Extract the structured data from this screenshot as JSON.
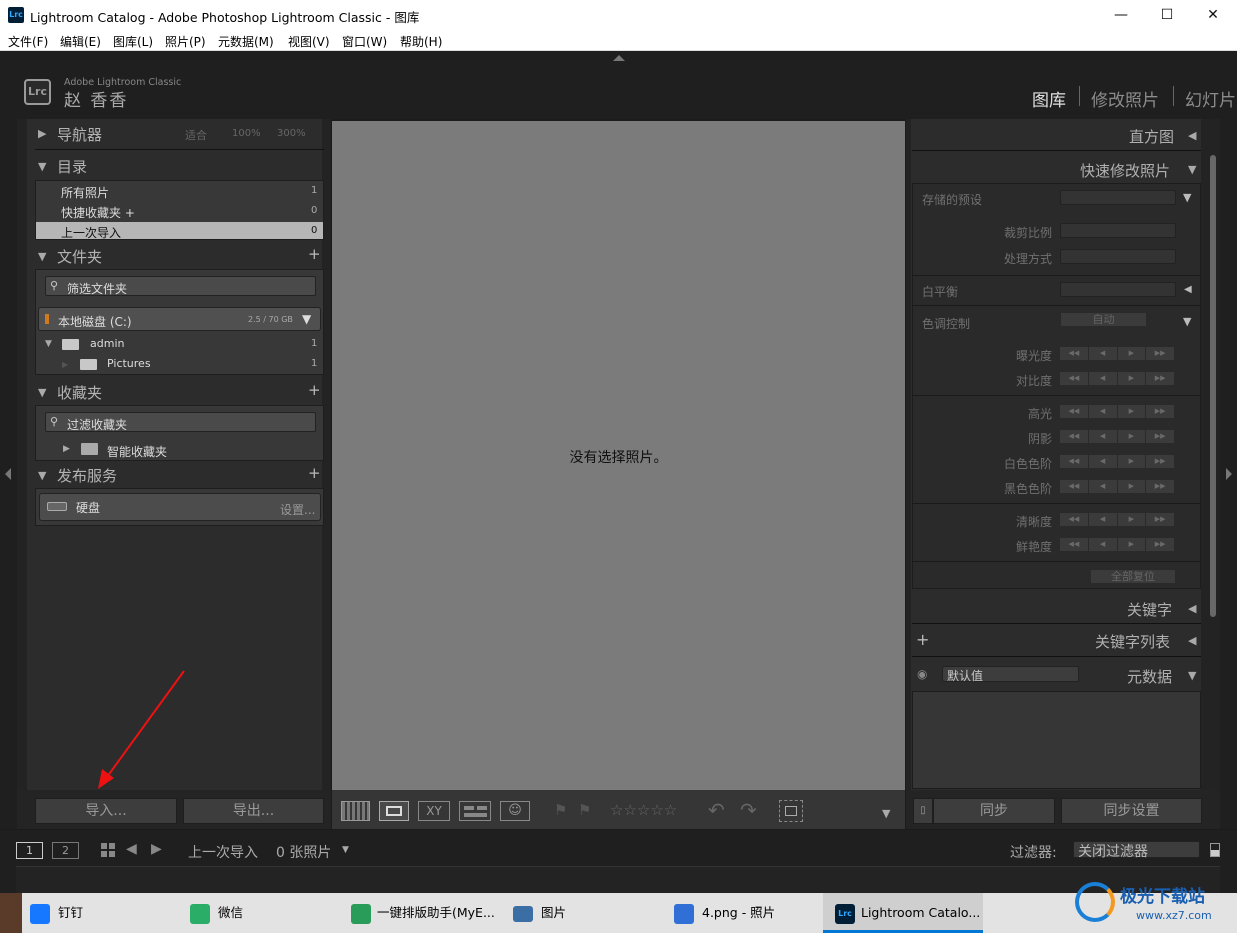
{
  "window": {
    "title": "Lightroom Catalog - Adobe Photoshop Lightroom Classic - 图库",
    "app_icon": "Lrc",
    "minimize": "—",
    "maximize": "☐",
    "close": "✕"
  },
  "menu": [
    "文件(F)",
    "编辑(E)",
    "图库(L)",
    "照片(P)",
    "元数据(M)",
    "视图(V)",
    "窗口(W)",
    "帮助(H)"
  ],
  "identity": {
    "logo": "Lrc",
    "brand": "Adobe Lightroom Classic",
    "name": "赵 香香"
  },
  "modules": [
    "图库",
    "修改照片",
    "幻灯片"
  ],
  "left": {
    "navigator": {
      "title": "导航器",
      "zoom": [
        "适合",
        "100%",
        "300%"
      ]
    },
    "catalog": {
      "title": "目录",
      "items": [
        {
          "label": "所有照片",
          "count": "1"
        },
        {
          "label": "快捷收藏夹 +",
          "count": "0"
        },
        {
          "label": "上一次导入",
          "count": "0"
        }
      ]
    },
    "folders": {
      "title": "文件夹",
      "filter_placeholder": "筛选文件夹",
      "volume": "本地磁盘 (C:)",
      "volume_size": "2.5 / 70 GB",
      "tree": [
        {
          "label": "admin",
          "count": "1"
        },
        {
          "label": "Pictures",
          "count": "1"
        }
      ]
    },
    "collections": {
      "title": "收藏夹",
      "filter_placeholder": "过滤收藏夹",
      "smart": "智能收藏夹"
    },
    "publish": {
      "title": "发布服务",
      "service": "硬盘",
      "setup": "设置..."
    },
    "import_button": "导入...",
    "export_button": "导出..."
  },
  "center": {
    "empty_message": "没有选择照片。"
  },
  "right": {
    "histogram": "直方图",
    "quick_develop": {
      "title": "快速修改照片",
      "saved_preset": "存储的预设",
      "crop_ratio": "裁剪比例",
      "treatment": "处理方式",
      "white_balance": "白平衡",
      "tone_control": "色调控制",
      "auto": "自动",
      "group1": [
        "曝光度",
        "对比度"
      ],
      "group2": [
        "高光",
        "阴影",
        "白色色阶",
        "黑色色阶"
      ],
      "group3": [
        "清晰度",
        "鲜艳度"
      ],
      "reset_all": "全部复位"
    },
    "keywords": "关键字",
    "keyword_list": "关键字列表",
    "metadata": "元数据",
    "metadata_preset": "默认值",
    "sync_button": "同步",
    "sync_settings_button": "同步设置"
  },
  "filmstrip": {
    "view1": "1",
    "view2": "2",
    "source": "上一次导入",
    "count": "0 张照片",
    "filter_label": "过滤器:",
    "filter_value": "关闭过滤器"
  },
  "taskbar": [
    {
      "label": "钉钉",
      "color": "#1677ff"
    },
    {
      "label": "微信",
      "color": "#2aae67"
    },
    {
      "label": "一键排版助手(MyE...",
      "color": "#2a9c5a"
    },
    {
      "label": "图片",
      "color": "#3a6ea5"
    },
    {
      "label": "4.png - 照片",
      "color": "#2f6fd6"
    },
    {
      "label": "Lightroom Catalo...",
      "color": "#001e36"
    }
  ],
  "watermark": {
    "name": "极光下载站",
    "url": "www.xz7.com"
  }
}
